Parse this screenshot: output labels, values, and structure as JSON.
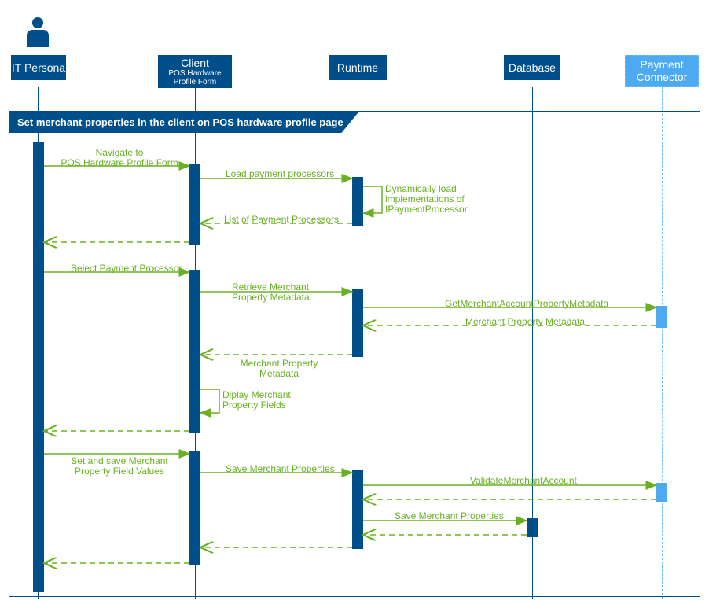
{
  "participants": {
    "p1": {
      "title": "IT Persona"
    },
    "p2": {
      "title": "Client",
      "sub1": "POS Hardware",
      "sub2": "Profile Form"
    },
    "p3": {
      "title": "Runtime"
    },
    "p4": {
      "title": "Database"
    },
    "p5": {
      "title": "Payment",
      "sub1": "Connector"
    }
  },
  "frame": {
    "title": "Set merchant properties in the client on POS hardware profile page"
  },
  "messages": {
    "m1a": "Navigate to",
    "m1b": "POS Hardware Profile Form",
    "m2": "Load payment processors",
    "m3a": "Dynamically load",
    "m3b": "implementations of",
    "m3c": "IPaymentProcessor",
    "m4": "List of Payment Processors",
    "m6": "Select Payment Processor",
    "m7": "Retrieve Merchant",
    "m7b": "Property Metadata",
    "m8": "GetMerchantAccountPropertyMetadata",
    "m9": "Merchant Property Metadata",
    "m10": "Merchant Property",
    "m10b": "Metadata",
    "m11": "Diplay Merchant",
    "m11b": "Property Fields",
    "m13": "Set and save Merchant",
    "m13b": "Property Field Values",
    "m14": "Save Merchant Properties",
    "m15": "ValidateMerchantAccount",
    "m17": "Save Merchant Properties"
  }
}
